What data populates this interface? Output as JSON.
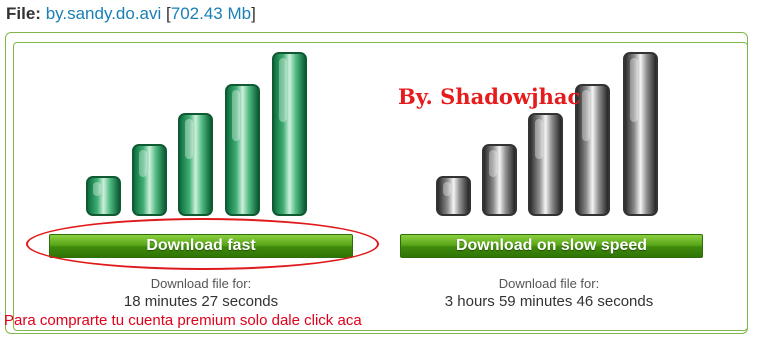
{
  "file": {
    "label": "File:",
    "name": "by.sandy.do.avi",
    "open_bracket": "[",
    "size": "702.43 Mb",
    "close_bracket": "]"
  },
  "fast": {
    "button_label": "Download fast",
    "caption": "Download file for:",
    "time": "18 minutes 27 seconds",
    "color": "#2e9e5e"
  },
  "slow": {
    "button_label": "Download on slow speed",
    "caption": "Download file for:",
    "time": "3 hours 59 minutes 46 seconds",
    "color": "#888888"
  },
  "watermark": "By. Shadowjhac",
  "promo": "Para comprarte tu cuenta premium solo dale click aca",
  "colors": {
    "accent_green": "#4f9f18",
    "link_blue": "#1a7fb5",
    "annotation_red": "#e01a1a"
  }
}
